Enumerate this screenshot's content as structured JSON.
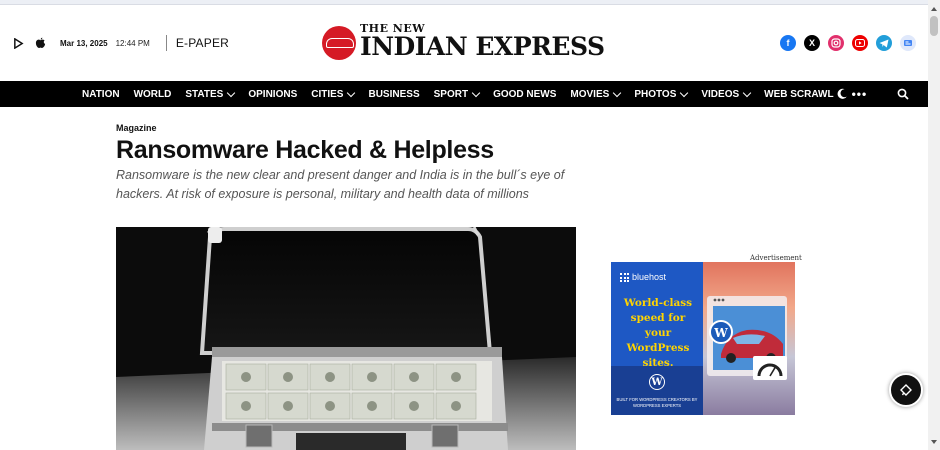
{
  "header": {
    "date": "Mar 13, 2025",
    "time": "12:44 PM",
    "epaper_label": "E-PAPER",
    "logo_line1": "THE NEW",
    "logo_line2": "INDIAN EXPRESS",
    "brand_color": "#d51a25",
    "store_icons": [
      "google-play-icon",
      "apple-icon"
    ],
    "social_icons": [
      {
        "name": "facebook-icon",
        "color": "#1877f2"
      },
      {
        "name": "x-icon",
        "color": "#000000"
      },
      {
        "name": "instagram-icon",
        "color": "#e1306c"
      },
      {
        "name": "youtube-icon",
        "color": "#ff0000"
      },
      {
        "name": "telegram-icon",
        "color": "#229ed9"
      },
      {
        "name": "google-news-icon",
        "color": "#4285f4"
      }
    ]
  },
  "nav": {
    "items": [
      {
        "label": "NATION",
        "dropdown": false
      },
      {
        "label": "WORLD",
        "dropdown": false
      },
      {
        "label": "STATES",
        "dropdown": true
      },
      {
        "label": "OPINIONS",
        "dropdown": false
      },
      {
        "label": "CITIES",
        "dropdown": true
      },
      {
        "label": "BUSINESS",
        "dropdown": false
      },
      {
        "label": "SPORT",
        "dropdown": true
      },
      {
        "label": "GOOD NEWS",
        "dropdown": false
      },
      {
        "label": "MOVIES",
        "dropdown": true
      },
      {
        "label": "PHOTOS",
        "dropdown": true
      },
      {
        "label": "VIDEOS",
        "dropdown": true
      },
      {
        "label": "WEB SCRAWL",
        "dropdown": false
      }
    ],
    "more_label": "•••",
    "icons": [
      "more-icon",
      "dark-mode-moon-icon",
      "search-icon"
    ]
  },
  "article": {
    "category": "Magazine",
    "headline": "Ransomware Hacked & Helpless",
    "standfirst": "Ransomware is the new clear and present danger and India is in the bull´s eye of hackers. At risk of exposure is personal, military and health data of millions"
  },
  "ad": {
    "label": "Advertisement",
    "brand": "bluehost",
    "headline": "World-class speed for your WordPress sites.",
    "wp_glyph": "W",
    "fine_print": "BUILT FOR WORDPRESS CREATORS BY WORDPRESS EXPERTS",
    "colors": {
      "blue": "#1e58c4",
      "yellow": "#ffd400"
    }
  },
  "chat": {
    "icon": "chat-bubble-icon"
  }
}
